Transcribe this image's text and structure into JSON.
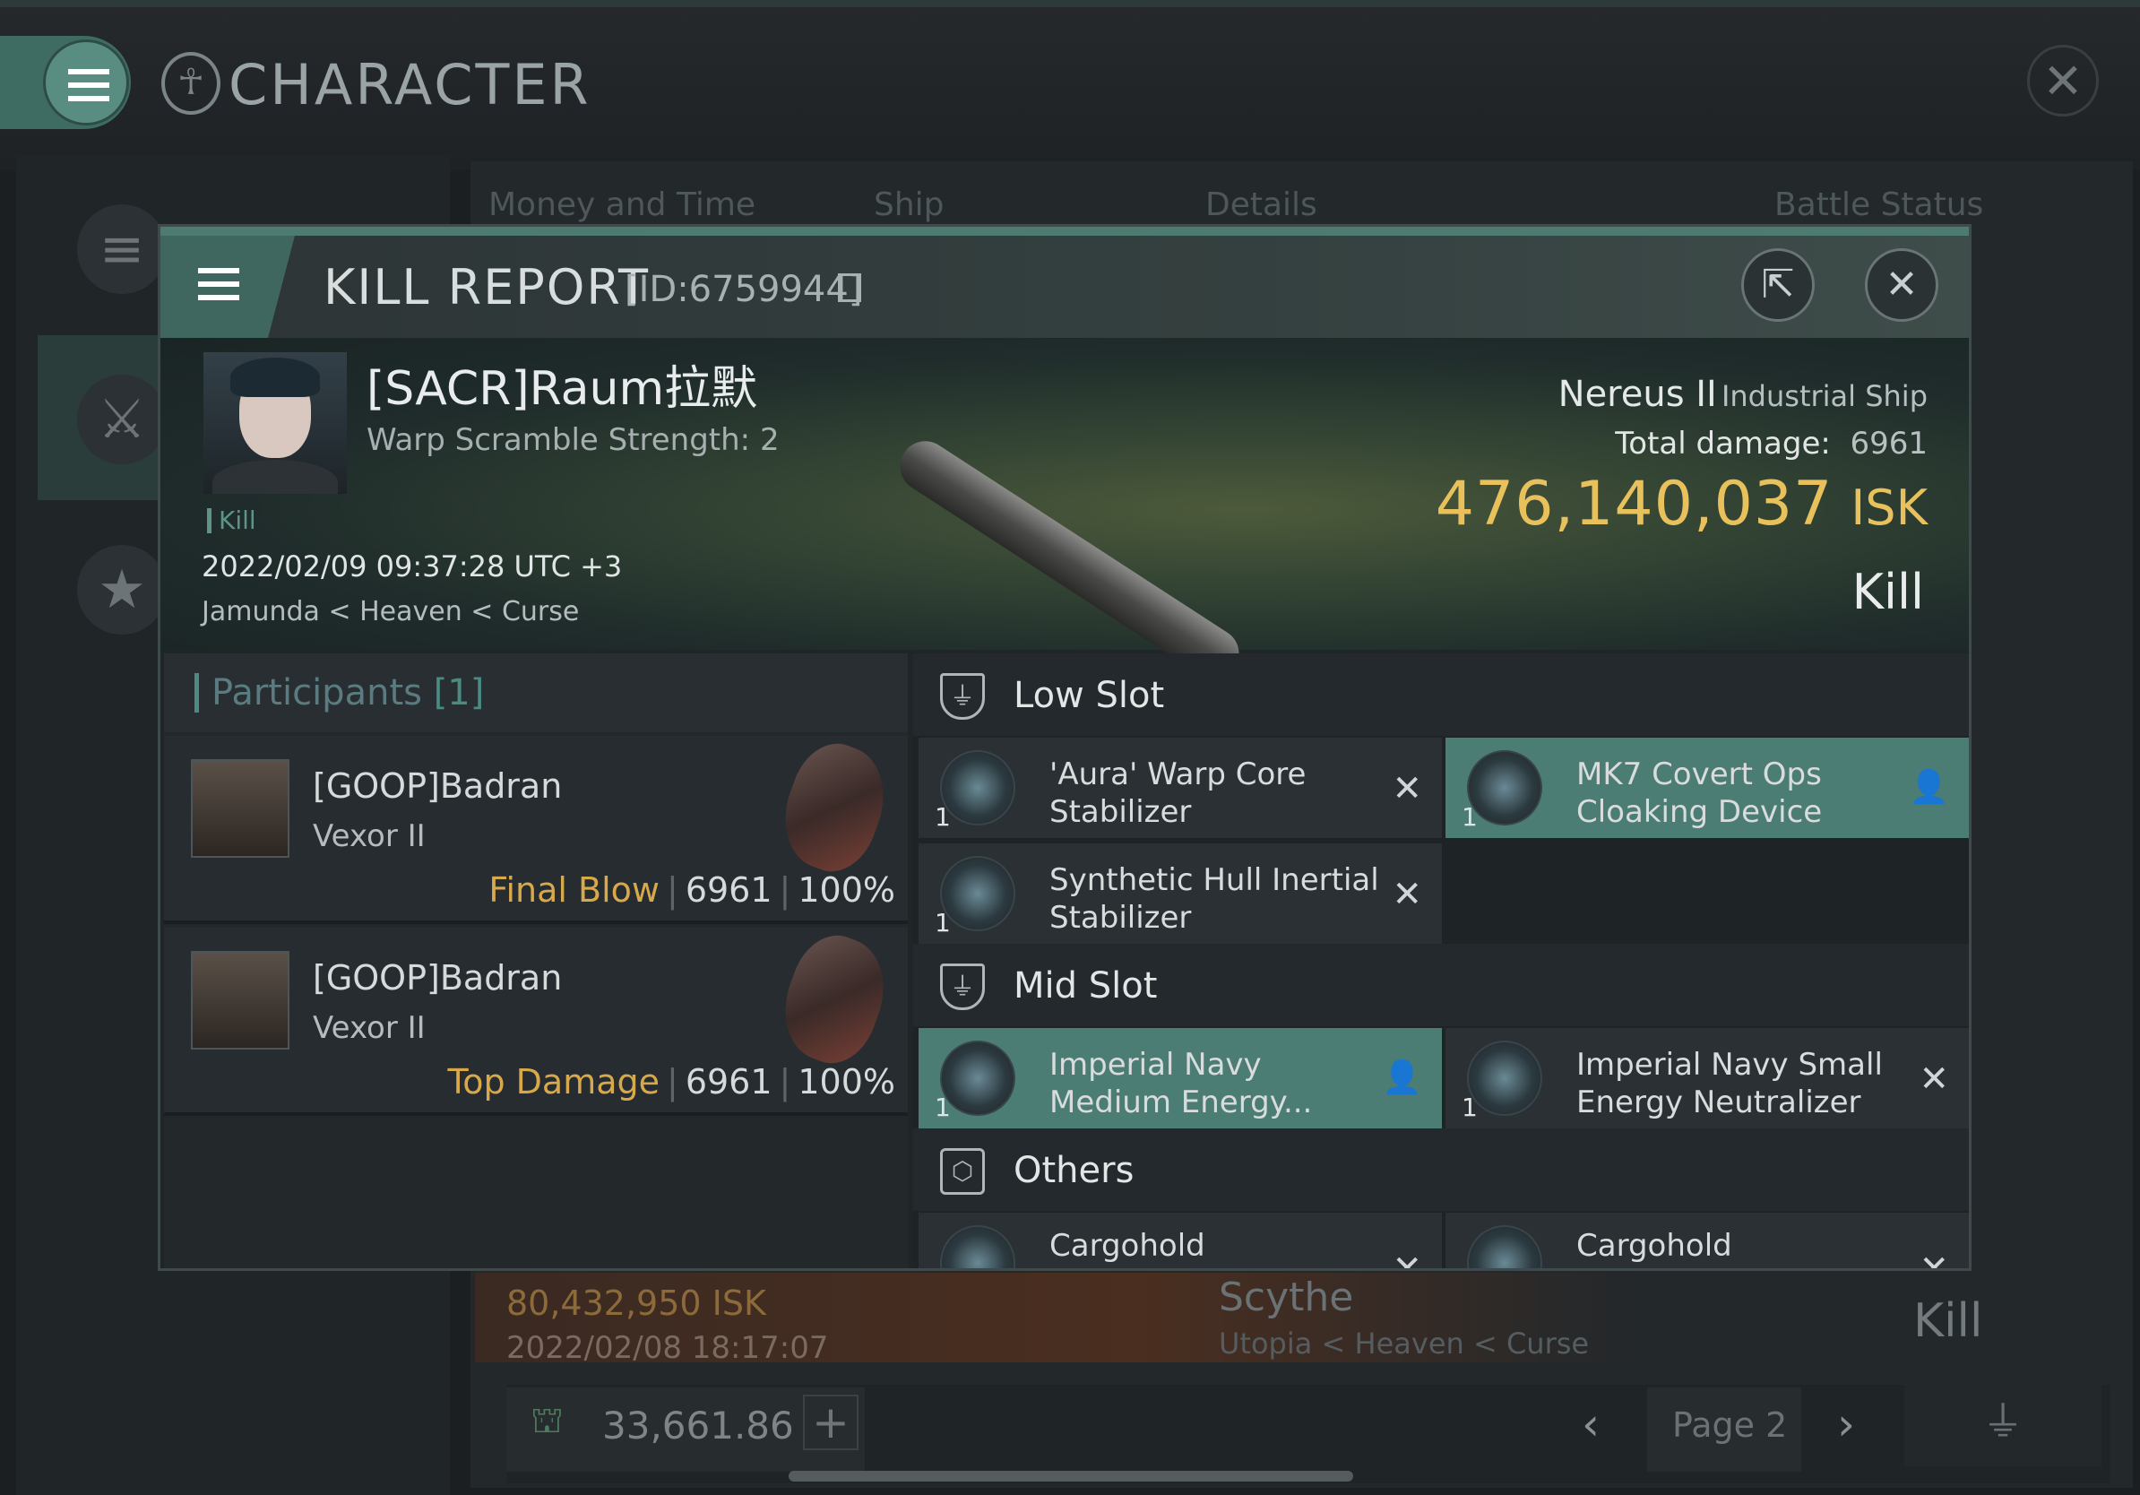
{
  "app": {
    "title": "CHARACTER",
    "close": "✕"
  },
  "bg_tabs": [
    "Money and Time",
    "Ship",
    "Details",
    "Battle Status"
  ],
  "bg_row": {
    "isk": "80,432,950  ISK",
    "date": "2022/02/08  18:17:07",
    "ship": "Scythe",
    "location": "Utopia < Heaven < Curse",
    "result": "Kill"
  },
  "bg_footer": {
    "balance": "33,661.86",
    "page": "Page 2"
  },
  "modal": {
    "title": "KILL REPORT",
    "id": "[ID:6759944]"
  },
  "victim": {
    "name": "[SACR]Raum拉默",
    "scramble": "Warp Scramble Strength: 2",
    "tag": "Kill",
    "datetime": "2022/02/09 09:37:28 UTC +3",
    "location": "Jamunda < Heaven < Curse",
    "ship_name": "Nereus II",
    "ship_class": "Industrial Ship",
    "total_damage_label": "Total damage:",
    "total_damage": "6961",
    "isk_value": "476,140,037",
    "isk_unit": "ISK",
    "result": "Kill"
  },
  "participants": {
    "title": "Participants",
    "count": "[1]",
    "rows": [
      {
        "name": "[GOOP]Badran",
        "ship": "Vexor II",
        "label": "Final Blow",
        "damage": "6961",
        "percent": "100%"
      },
      {
        "name": "[GOOP]Badran",
        "ship": "Vexor II",
        "label": "Top Damage",
        "damage": "6961",
        "percent": "100%"
      }
    ]
  },
  "fitting": {
    "low_slot": {
      "title": "Low Slot",
      "items": [
        {
          "qty": "1",
          "name": "'Aura' Warp Core Stabilizer",
          "status": "destroyed"
        },
        {
          "qty": "1",
          "name": "MK7 Covert Ops Cloaking Device",
          "status": "dropped"
        },
        {
          "qty": "1",
          "name": "Synthetic Hull Inertial Stabilizer",
          "status": "destroyed"
        }
      ]
    },
    "mid_slot": {
      "title": "Mid Slot",
      "items": [
        {
          "qty": "1",
          "name": "Imperial Navy Medium Energy...",
          "status": "dropped"
        },
        {
          "qty": "1",
          "name": "Imperial Navy Small Energy Neutralizer",
          "status": "destroyed"
        }
      ]
    },
    "others": {
      "title": "Others",
      "items": [
        {
          "qty": "",
          "name": "Cargohold",
          "status": "destroyed"
        },
        {
          "qty": "",
          "name": "Cargohold",
          "status": "destroyed"
        }
      ]
    }
  },
  "colors": {
    "accent": "#4b7d74",
    "isk": "#e8c15c",
    "label_gold": "#d8a94a"
  },
  "icons": {
    "destroyed": "✕",
    "dropped": "person-icon"
  }
}
